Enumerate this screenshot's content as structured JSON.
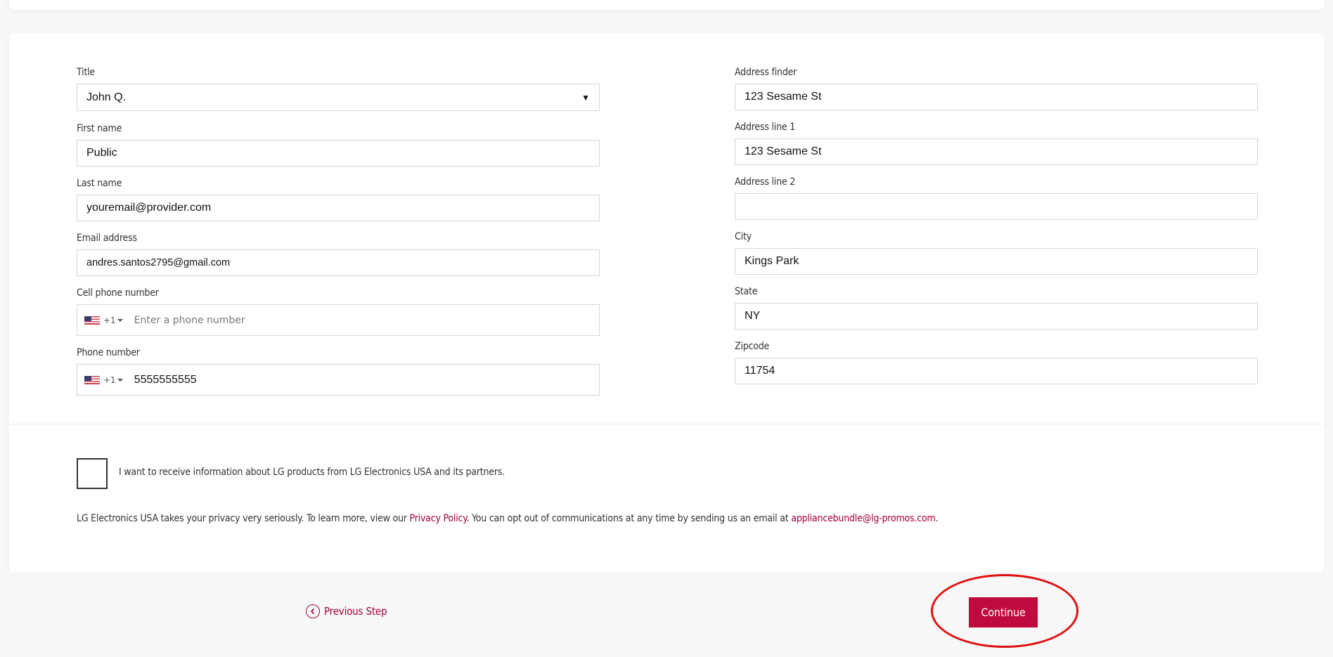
{
  "form": {
    "left_column": [
      {
        "label": "Title",
        "value": "John Q.",
        "type": "select"
      },
      {
        "label": "First name",
        "value": "Public",
        "type": "text"
      },
      {
        "label": "Last name",
        "value": "youremail@provider.com",
        "type": "text"
      },
      {
        "label": "Email address",
        "value": "andres.santos2795@gmail.com",
        "type": "text"
      },
      {
        "label": "Cell phone number",
        "value": "",
        "placeholder": "Enter a phone number",
        "country_code": "+1",
        "country_icon": "us-flag-icon",
        "type": "phone"
      },
      {
        "label": "Phone number",
        "value": "5555555555",
        "country_code": "+1",
        "country_icon": "us-flag-icon",
        "type": "phone"
      }
    ],
    "right_column": [
      {
        "label": "Address finder",
        "value": "123 Sesame St"
      },
      {
        "label": "Address line 1",
        "value": "123 Sesame St"
      },
      {
        "label": "Address line 2",
        "value": ""
      },
      {
        "label": "City",
        "value": "Kings Park"
      },
      {
        "label": "State",
        "value": "NY"
      },
      {
        "label": "Zipcode",
        "value": "11754"
      }
    ]
  },
  "consent": {
    "checked": false,
    "text": "I want to receive information about LG products from LG Electronics USA and its partners."
  },
  "privacy": {
    "text_before": "LG Electronics USA takes your privacy very seriously. To learn more, view our ",
    "policy_link": "Privacy Policy",
    "text_middle": ". You can opt out of communications at any time by sending us an email at ",
    "email_link": "appliancebundle@lg-promos.com",
    "text_after": "."
  },
  "navigation": {
    "previous_label": "Previous Step",
    "continue_label": "Continue"
  },
  "colors": {
    "brand": "#a50034",
    "button": "#be0a3c",
    "annotation": "#e11010"
  }
}
